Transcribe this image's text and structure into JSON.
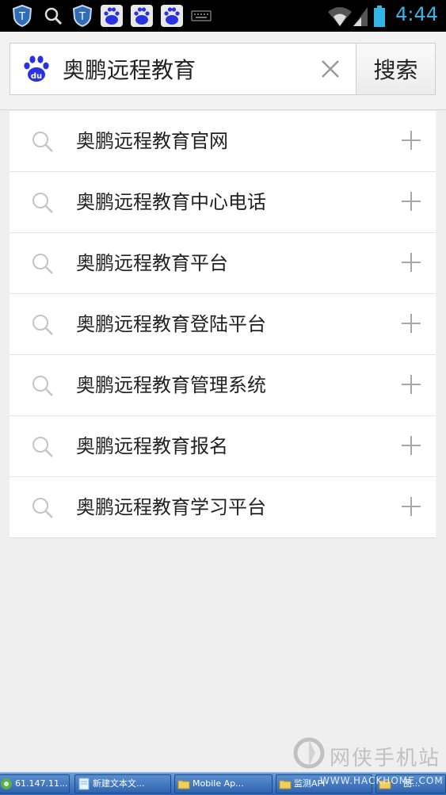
{
  "status_bar": {
    "time": "4:44",
    "icons": [
      "shield-app-icon",
      "search-icon",
      "shield-app-icon",
      "baidu-app-icon",
      "baidu-app-icon",
      "baidu-app-icon",
      "keyboard-icon",
      "wifi-icon",
      "signal-icon",
      "battery-icon"
    ],
    "time_color": "#33b5e5"
  },
  "search": {
    "query": "奥鹏远程教育",
    "button_label": "搜索",
    "logo_icon": "baidu-paw-icon",
    "clear_icon": "close-icon"
  },
  "suggestions": [
    {
      "text": "奥鹏远程教育官网"
    },
    {
      "text": "奥鹏远程教育中心电话"
    },
    {
      "text": "奥鹏远程教育平台"
    },
    {
      "text": "奥鹏远程教育登陆平台"
    },
    {
      "text": "奥鹏远程教育管理系统"
    },
    {
      "text": "奥鹏远程教育报名"
    },
    {
      "text": "奥鹏远程教育学习平台"
    }
  ],
  "watermark": {
    "text": "网侠手机站",
    "url": "WWW.HACKHOME.COM"
  },
  "taskbar": {
    "tasks": [
      {
        "label": "61.147.11..."
      },
      {
        "label": "新建文本文..."
      },
      {
        "label": "Mobile Ap..."
      },
      {
        "label": "监测API"
      },
      {
        "label": "图..."
      }
    ]
  },
  "colors": {
    "accent": "#33b5e5",
    "baidu_blue": "#2932e1",
    "taskbar_blue": "#2c64b3"
  }
}
